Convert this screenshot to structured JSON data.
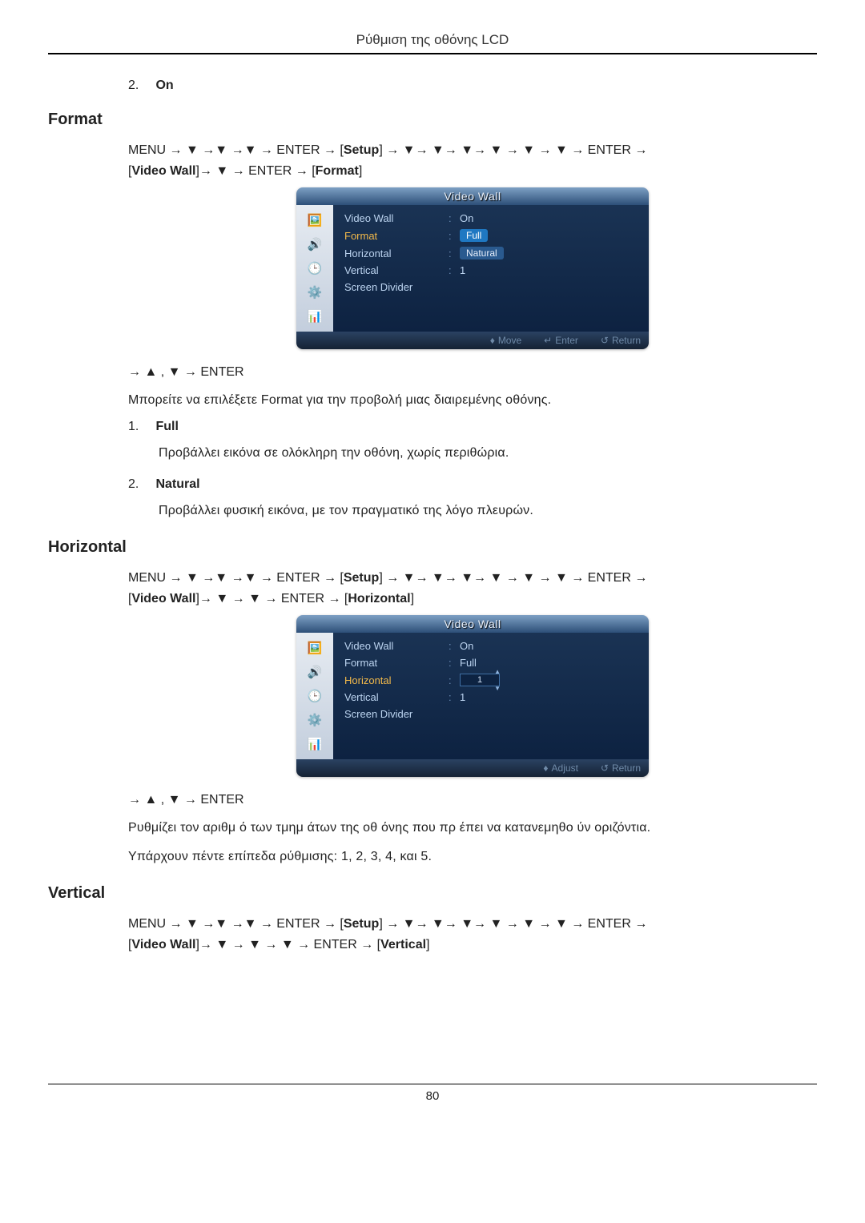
{
  "page_header": "Ρύθμιση της οθόνης LCD",
  "page_number": "80",
  "item_on": {
    "num": "2.",
    "label": "On"
  },
  "format": {
    "heading": "Format",
    "nav1": "MENU → ▼ →▼ →▼ → ENTER → [",
    "nav_setup": "Setup",
    "nav2": "] → ▼→ ▼→ ▼→ ▼ → ▼ → ▼ → ENTER →",
    "nav3": "[",
    "nav_vw": "Video Wall",
    "nav4": "]→ ▼ → ENTER → [",
    "nav_fmt": "Format",
    "nav5": "]",
    "subnav": "→ ▲ , ▼ → ENTER",
    "desc": "Μπορείτε να επιλέξετε Format για την προβολή μιας διαιρεμένης οθόνης.",
    "opt1": {
      "num": "1.",
      "label": "Full",
      "desc": "Προβάλλει εικόνα σε ολόκληρη την οθόνη, χωρίς περιθώρια."
    },
    "opt2": {
      "num": "2.",
      "label": "Natural",
      "desc": "Προβάλλει φυσική εικόνα, με τον πραγματικό της λόγο πλευρών."
    }
  },
  "horizontal": {
    "heading": "Horizontal",
    "nav1": "MENU → ▼ →▼ →▼ → ENTER → [",
    "nav_setup": "Setup",
    "nav2": "] → ▼→ ▼→ ▼→ ▼ → ▼ → ▼ → ENTER →",
    "nav3": "[",
    "nav_vw": "Video Wall",
    "nav4": "]→ ▼ → ▼ → ENTER → [",
    "nav_h": "Horizontal",
    "nav5": "]",
    "subnav": "→ ▲ , ▼ → ENTER",
    "desc": "Ρυθμίζει τον αριθμ ό των τμημ άτων της οθ όνης που πρ έπει να κατανεμηθο ύν οριζόντια.",
    "levels": "Υπάρχουν πέντε επίπεδα ρύθμισης: 1, 2, 3, 4, και 5."
  },
  "vertical": {
    "heading": "Vertical",
    "nav1": "MENU → ▼ →▼ →▼ → ENTER → [",
    "nav_setup": "Setup",
    "nav2": "] → ▼→ ▼→ ▼→ ▼ → ▼ → ▼ → ENTER →",
    "nav3": "[",
    "nav_vw": "Video Wall",
    "nav4": "]→ ▼ → ▼ → ▼ → ENTER → [",
    "nav_v": "Vertical",
    "nav5": "]"
  },
  "osd1": {
    "title": "Video Wall",
    "rows": {
      "videowall": {
        "label": "Video Wall",
        "value": "On"
      },
      "format": {
        "label": "Format",
        "value_full": "Full",
        "value_nat": "Natural"
      },
      "horizontal": {
        "label": "Horizontal"
      },
      "vertical": {
        "label": "Vertical",
        "value": "1"
      },
      "divider": {
        "label": "Screen Divider"
      }
    },
    "footer": {
      "move": "Move",
      "enter": "Enter",
      "return": "Return"
    }
  },
  "osd2": {
    "title": "Video Wall",
    "rows": {
      "videowall": {
        "label": "Video Wall",
        "value": "On"
      },
      "format": {
        "label": "Format",
        "value": "Full"
      },
      "horizontal": {
        "label": "Horizontal"
      },
      "vertical": {
        "label": "Vertical",
        "value": "1"
      },
      "divider": {
        "label": "Screen Divider"
      }
    },
    "footer": {
      "adjust": "Adjust",
      "return": "Return"
    }
  }
}
